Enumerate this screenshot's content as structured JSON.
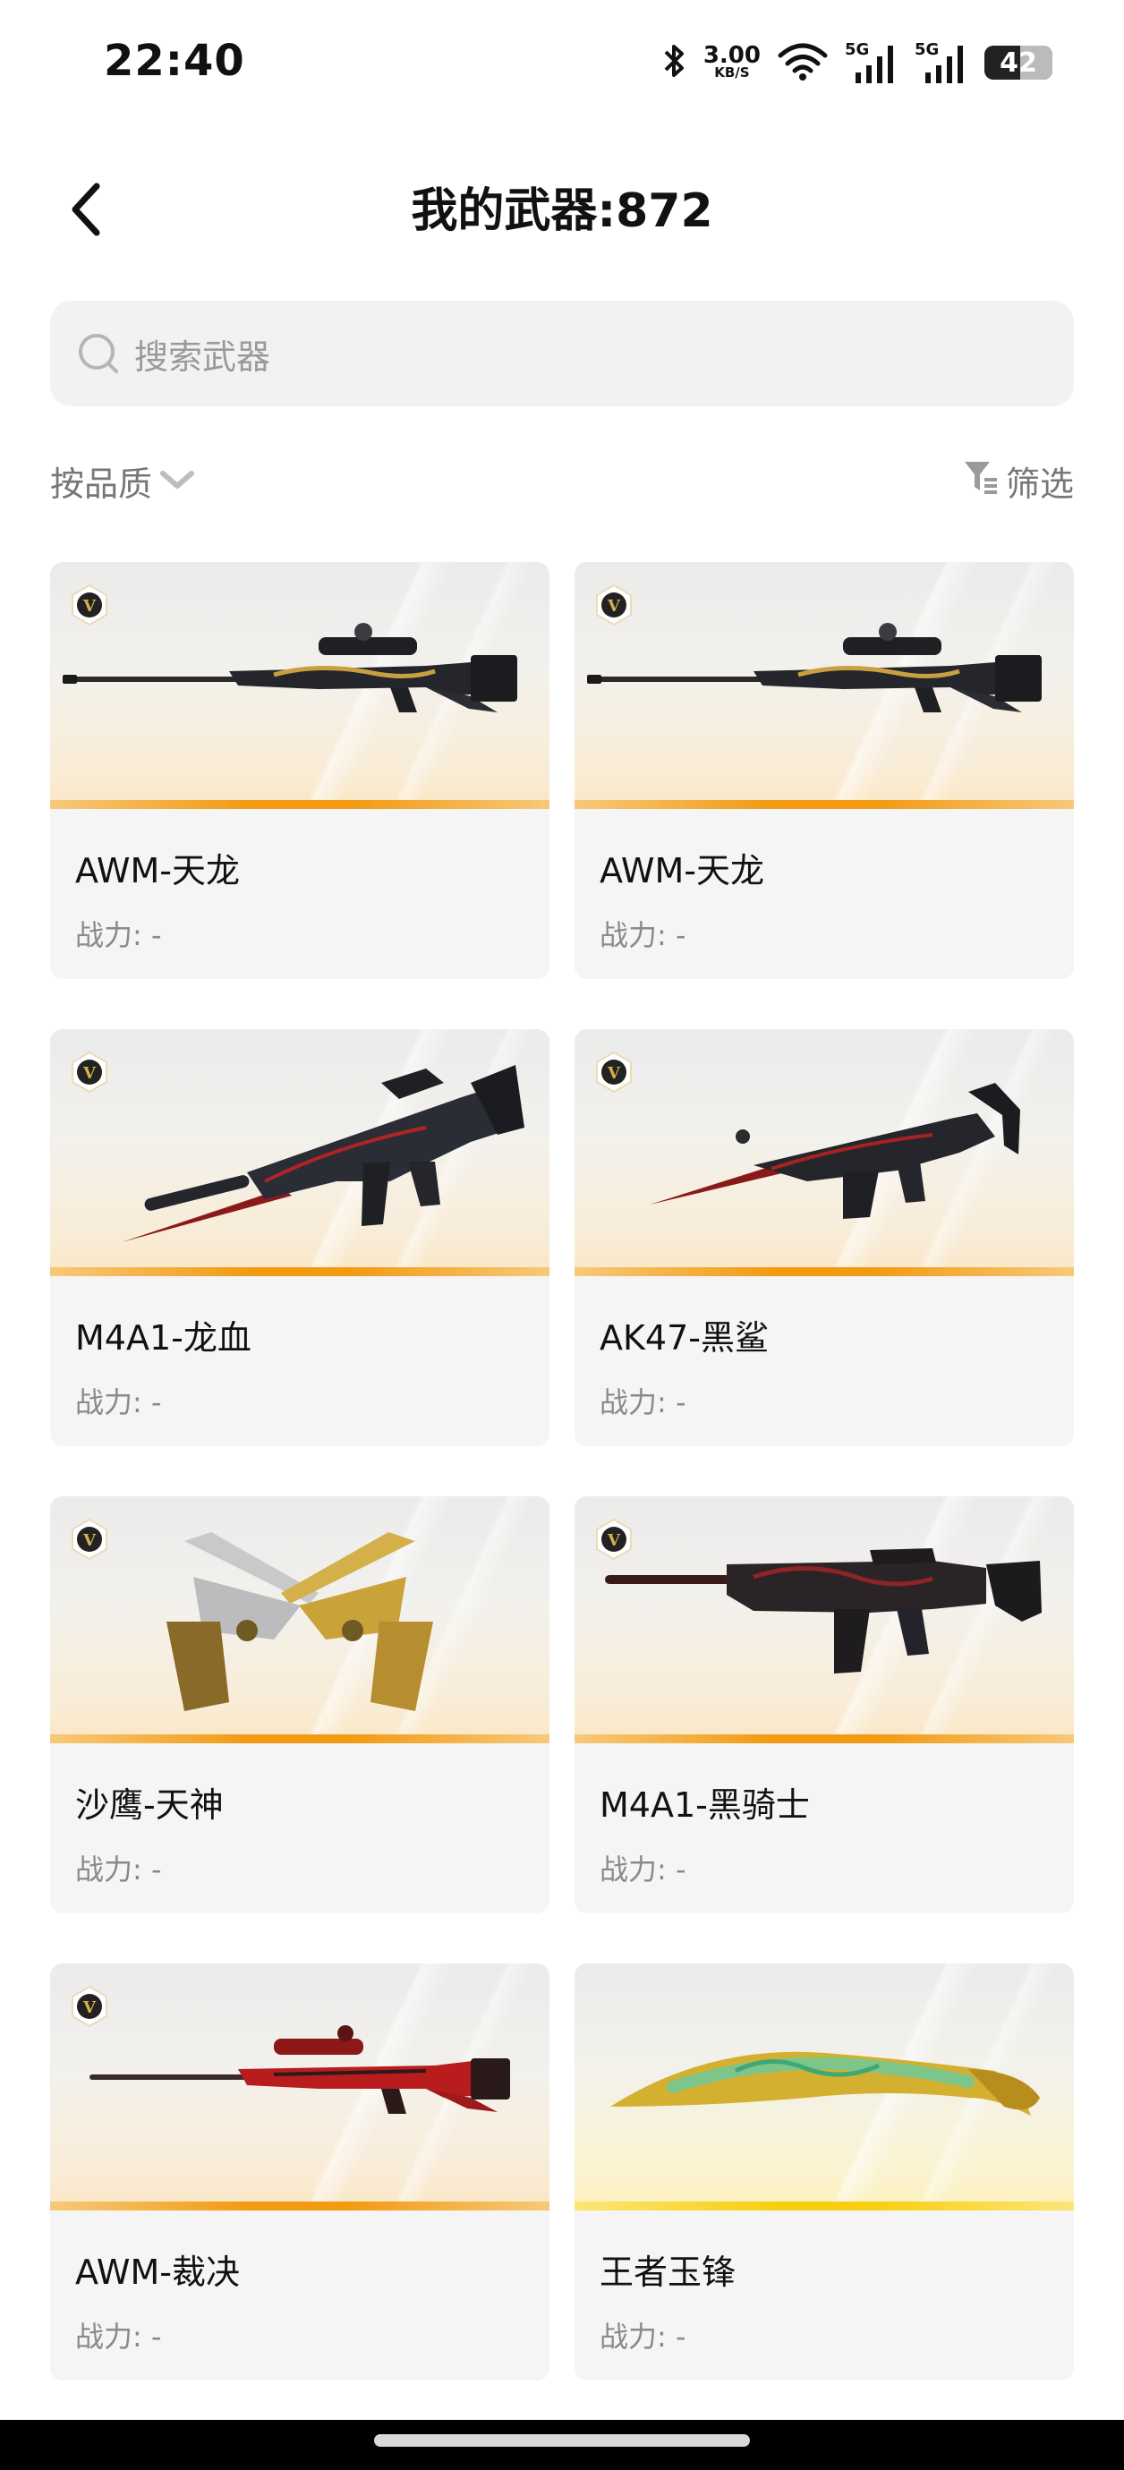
{
  "status_bar": {
    "time": "22:40",
    "net_speed_value": "3.00",
    "net_speed_unit": "KB/S",
    "signal_1_label": "5G",
    "signal_2_label": "5G",
    "battery": "42"
  },
  "header": {
    "title": "我的武器:872"
  },
  "search": {
    "placeholder": "搜索武器"
  },
  "sort": {
    "label": "按品质"
  },
  "filter": {
    "label": "筛选"
  },
  "weapons": [
    {
      "name": "AWM-天龙",
      "power": "战力: -",
      "badge": "V"
    },
    {
      "name": "AWM-天龙",
      "power": "战力: -",
      "badge": "V"
    },
    {
      "name": "M4A1-龙血",
      "power": "战力: -",
      "badge": "V"
    },
    {
      "name": "AK47-黑鲨",
      "power": "战力: -",
      "badge": "V"
    },
    {
      "name": "沙鹰-天神",
      "power": "战力: -",
      "badge": "V"
    },
    {
      "name": "M4A1-黑骑士",
      "power": "战力: -",
      "badge": "V"
    },
    {
      "name": "AWM-裁决",
      "power": "战力: -",
      "badge": "V"
    },
    {
      "name": "王者玉锋",
      "power": "战力: -"
    }
  ],
  "colors": {
    "quality_orange": "#f29a12",
    "quality_gold": "#f7cf10",
    "badge_gold": "#c9a23a"
  },
  "icons": [
    "back-arrow-icon",
    "search-icon",
    "chevron-down-icon",
    "filter-icon",
    "bluetooth-icon",
    "wifi-icon",
    "signal-icon",
    "battery-icon"
  ]
}
